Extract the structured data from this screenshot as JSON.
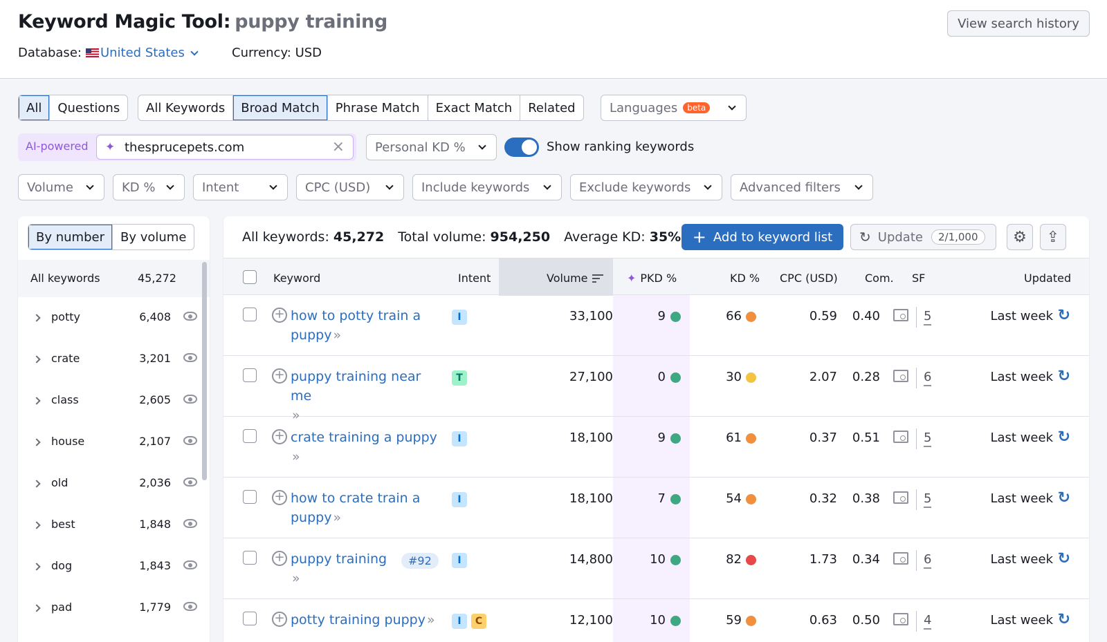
{
  "header": {
    "title": "Keyword Magic Tool:",
    "query": "puppy training",
    "database_label": "Database:",
    "database_country": "United States",
    "currency": "Currency: USD",
    "history_button": "View search history"
  },
  "filters": {
    "type_tabs": [
      "All",
      "Questions"
    ],
    "match_tabs": [
      "All Keywords",
      "Broad Match",
      "Phrase Match",
      "Exact Match",
      "Related"
    ],
    "languages": "Languages",
    "beta": "beta",
    "ai_label": "AI-powered",
    "domain_value": "thesprucepets.com",
    "personal_kd": "Personal KD %",
    "toggle_label": "Show ranking keywords",
    "dropdowns": [
      "Volume",
      "KD %",
      "Intent",
      "CPC (USD)",
      "Include keywords",
      "Exclude keywords",
      "Advanced filters"
    ]
  },
  "sidebar": {
    "tabs": [
      "By number",
      "By volume"
    ],
    "all_label": "All keywords",
    "all_count": "45,272",
    "groups": [
      {
        "label": "potty",
        "count": "6,408"
      },
      {
        "label": "crate",
        "count": "3,201"
      },
      {
        "label": "class",
        "count": "2,605"
      },
      {
        "label": "house",
        "count": "2,107"
      },
      {
        "label": "old",
        "count": "2,036"
      },
      {
        "label": "best",
        "count": "1,848"
      },
      {
        "label": "dog",
        "count": "1,843"
      },
      {
        "label": "pad",
        "count": "1,779"
      }
    ]
  },
  "summary": {
    "all_label": "All keywords:",
    "all_value": "45,272",
    "volume_label": "Total volume:",
    "volume_value": "954,250",
    "kd_label": "Average KD:",
    "kd_value": "35%",
    "add_button": "Add to keyword list",
    "update_button": "Update",
    "update_quota": "2/1,000"
  },
  "table": {
    "columns": {
      "keyword": "Keyword",
      "intent": "Intent",
      "volume": "Volume",
      "pkd": "PKD %",
      "kd": "KD %",
      "cpc": "CPC (USD)",
      "com": "Com.",
      "sf": "SF",
      "updated": "Updated"
    },
    "rows": [
      {
        "line1": "how to potty train a",
        "line2": "puppy",
        "rank": "",
        "intents": [
          "I"
        ],
        "volume": "33,100",
        "pkd": "9",
        "kd": "66",
        "kd_color": "#f08f3e",
        "cpc": "0.59",
        "com": "0.40",
        "sf": "5",
        "updated": "Last week"
      },
      {
        "line1": "puppy training near me",
        "line2": "",
        "rank": "",
        "intents": [
          "T"
        ],
        "volume": "27,100",
        "pkd": "0",
        "kd": "30",
        "kd_color": "#f5c342",
        "cpc": "2.07",
        "com": "0.28",
        "sf": "6",
        "updated": "Last week"
      },
      {
        "line1": "crate training a puppy",
        "line2": "",
        "rank": "",
        "intents": [
          "I"
        ],
        "volume": "18,100",
        "pkd": "9",
        "kd": "61",
        "kd_color": "#f08f3e",
        "cpc": "0.37",
        "com": "0.51",
        "sf": "5",
        "updated": "Last week"
      },
      {
        "line1": "how to crate train a",
        "line2": "puppy",
        "rank": "",
        "intents": [
          "I"
        ],
        "volume": "18,100",
        "pkd": "7",
        "kd": "54",
        "kd_color": "#f08f3e",
        "cpc": "0.32",
        "com": "0.38",
        "sf": "5",
        "updated": "Last week"
      },
      {
        "line1": "puppy training",
        "line2": "",
        "rank": "#92",
        "intents": [
          "I"
        ],
        "volume": "14,800",
        "pkd": "10",
        "kd": "82",
        "kd_color": "#e84848",
        "cpc": "1.73",
        "com": "0.34",
        "sf": "6",
        "updated": "Last week"
      },
      {
        "line1": "potty training puppy",
        "line2": "",
        "rank": "",
        "intents": [
          "I",
          "C"
        ],
        "volume": "12,100",
        "pkd": "10",
        "kd": "59",
        "kd_color": "#f08f3e",
        "cpc": "0.63",
        "com": "0.50",
        "sf": "4",
        "updated": "Last week"
      }
    ],
    "pkd_color": "#3fa883"
  }
}
